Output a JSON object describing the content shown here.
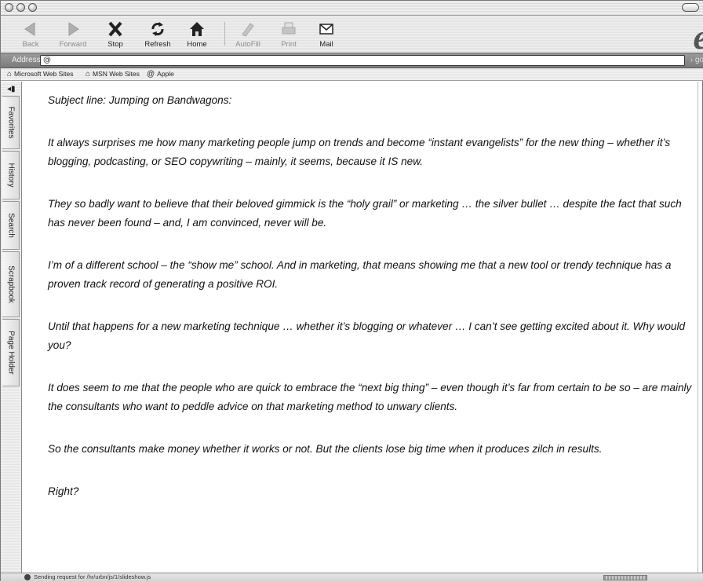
{
  "toolbar": {
    "buttons": [
      {
        "label": "Back",
        "icon": "back-arrow-icon",
        "enabled": false
      },
      {
        "label": "Forward",
        "icon": "forward-arrow-icon",
        "enabled": false
      },
      {
        "label": "Stop",
        "icon": "stop-x-icon",
        "enabled": true
      },
      {
        "label": "Refresh",
        "icon": "refresh-icon",
        "enabled": true
      },
      {
        "label": "Home",
        "icon": "home-icon",
        "enabled": true
      },
      {
        "label": "AutoFill",
        "icon": "autofill-icon",
        "enabled": false
      },
      {
        "label": "Print",
        "icon": "print-icon",
        "enabled": false
      },
      {
        "label": "Mail",
        "icon": "mail-icon",
        "enabled": true
      }
    ]
  },
  "address": {
    "label": "Address:",
    "value": "@",
    "go_label": "› go"
  },
  "favorites_bar": {
    "items": [
      {
        "label": "Microsoft Web Sites",
        "icon": "folder-link-icon"
      },
      {
        "label": "MSN Web Sites",
        "icon": "folder-link-icon"
      },
      {
        "label": "Apple",
        "icon": "at-sign-icon"
      }
    ]
  },
  "sidebar": {
    "tabs": [
      "Favorites",
      "History",
      "Search",
      "Scrapbook",
      "Page Holder"
    ]
  },
  "content": {
    "paragraphs": [
      "Subject line: Jumping on Bandwagons:",
      "It always surprises me how many marketing people jump on trends and become “instant evangelists” for the new thing – whether it’s blogging, podcasting, or SEO copywriting – mainly, it seems, because it IS new.",
      "They so badly want to believe that their beloved gimmick is the “holy grail” or marketing … the silver bullet … despite the fact that such has never been found – and, I am convinced, never will be.",
      "I’m of a different school – the “show me” school. And in marketing, that means showing me that a new tool or trendy technique has a proven track record of generating a positive ROI.",
      "Until that happens for a new marketing technique … whether it’s blogging or whatever … I can’t see getting excited about it. Why would you?",
      "It does seem to me that the people who are quick to embrace the “next big thing” – even though it’s far from certain to be so – are mainly the consultants who want to peddle advice on that marketing method to unwary clients.",
      "So the consultants make money whether it works or not. But the clients lose big time when it produces zilch in results.",
      "Right?"
    ]
  },
  "status": {
    "text": "Sending request for /hr/urbn/js/1/slideshow.js"
  }
}
